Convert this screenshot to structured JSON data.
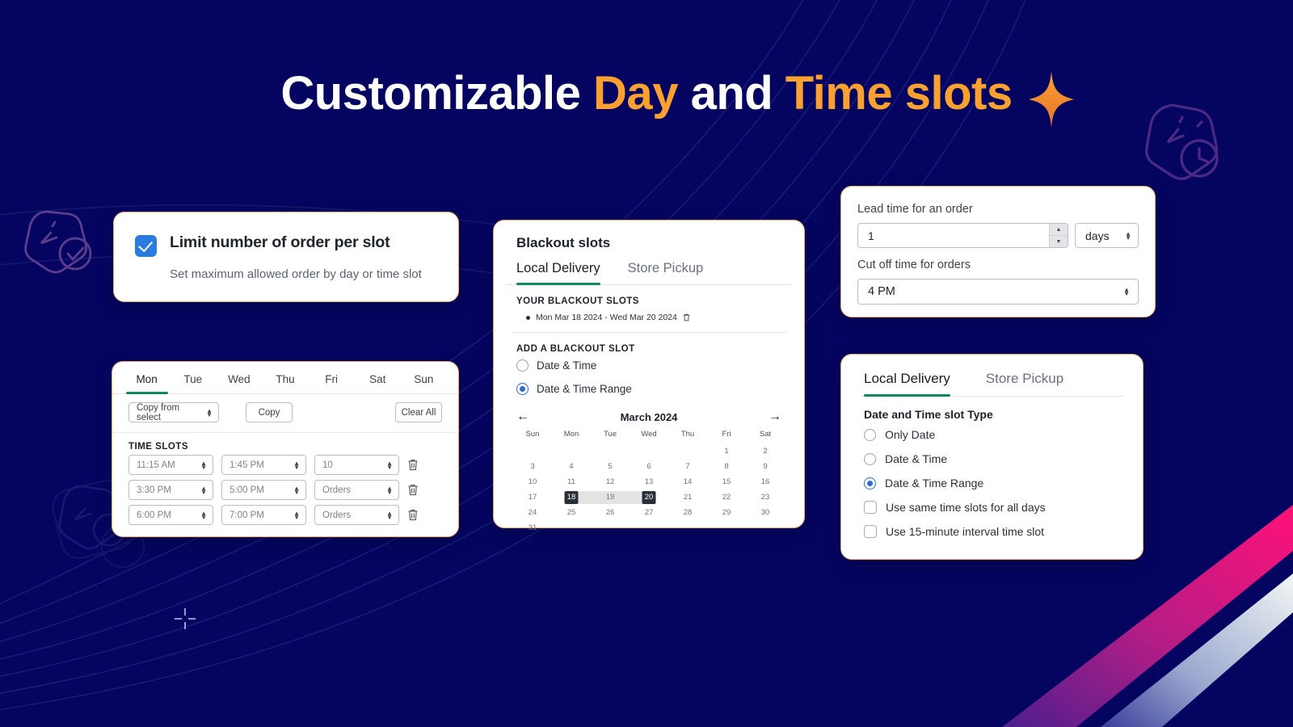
{
  "page": {
    "title_part1": "Customizable ",
    "title_accent1": "Day",
    "title_part2": " and ",
    "title_accent2": "Time slots",
    "background_color": "#050561",
    "accent_orange": "#f9a130",
    "card_border_color": "#f0a868",
    "tab_underline_green": "#0f8a5f",
    "radio_blue": "#2b6fd4",
    "checkbox_blue": "#2b7ae0"
  },
  "limit_card": {
    "title": "Limit number of order per slot",
    "subtitle": "Set maximum allowed order by day or time slot",
    "checkbox_checked": "true"
  },
  "slots_card": {
    "days": [
      {
        "label": "Mon",
        "active": true
      },
      {
        "label": "Tue",
        "active": false
      },
      {
        "label": "Wed",
        "active": false
      },
      {
        "label": "Thu",
        "active": false
      },
      {
        "label": "Fri",
        "active": false
      },
      {
        "label": "Sat",
        "active": false
      },
      {
        "label": "Sun",
        "active": false
      }
    ],
    "copy_from_label": "Copy from select",
    "copy_button": "Copy",
    "clear_all_button": "Clear All",
    "time_slots_label": "TIME SLOTS",
    "rows": [
      {
        "start": "11:15 AM",
        "end": "1:45 PM",
        "orders": "10"
      },
      {
        "start": "3:30 PM",
        "end": "5:00 PM",
        "orders": "Orders"
      },
      {
        "start": "6:00 PM",
        "end": "7:00 PM",
        "orders": "Orders"
      }
    ]
  },
  "blackout_card": {
    "title": "Blackout slots",
    "tabs": [
      {
        "label": "Local Delivery",
        "active": true
      },
      {
        "label": "Store Pickup",
        "active": false
      }
    ],
    "your_slots_label": "YOUR BLACKOUT SLOTS",
    "existing_slot": "Mon Mar 18 2024 - Wed Mar 20 2024",
    "add_slot_label": "ADD A BLACKOUT SLOT",
    "options": [
      {
        "label": "Date & Time",
        "selected": false
      },
      {
        "label": "Date & Time Range",
        "selected": true
      }
    ],
    "calendar": {
      "month": "March 2024",
      "prev_arrow": "←",
      "next_arrow": "→",
      "weekdays": [
        "Sun",
        "Mon",
        "Tue",
        "Wed",
        "Thu",
        "Fri",
        "Sat"
      ],
      "lead_blanks": 5,
      "days_in_month": 31,
      "range_start": 18,
      "range_end": 20
    }
  },
  "lead_card": {
    "lead_label": "Lead time for an order",
    "lead_value": "1",
    "unit_value": "days",
    "cutoff_label": "Cut off time for orders",
    "cutoff_value": "4 PM"
  },
  "type_card": {
    "tabs": [
      {
        "label": "Local Delivery",
        "active": true
      },
      {
        "label": "Store Pickup",
        "active": false
      }
    ],
    "heading": "Date and Time slot Type",
    "radios": [
      {
        "label": "Only Date",
        "selected": false
      },
      {
        "label": "Date & Time",
        "selected": false
      },
      {
        "label": "Date & Time Range",
        "selected": true
      }
    ],
    "checkboxes": [
      {
        "label": "Use same time slots for all days",
        "checked": false
      },
      {
        "label": "Use 15-minute interval time slot",
        "checked": false
      }
    ]
  }
}
